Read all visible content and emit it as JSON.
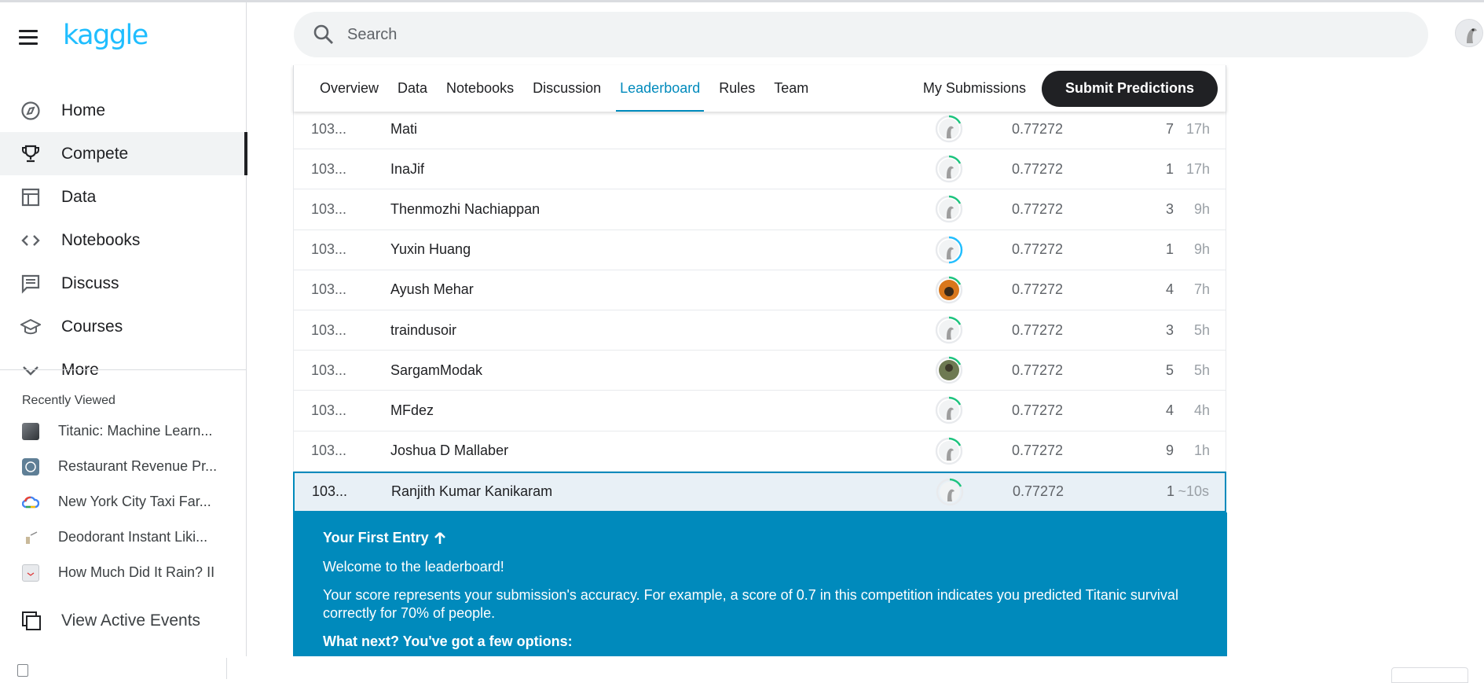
{
  "app": {
    "logo": "kaggle"
  },
  "sidebar": {
    "items": [
      {
        "label": "Home",
        "icon": "compass-icon"
      },
      {
        "label": "Compete",
        "icon": "trophy-icon",
        "active": true
      },
      {
        "label": "Data",
        "icon": "table-icon"
      },
      {
        "label": "Notebooks",
        "icon": "code-icon"
      },
      {
        "label": "Discuss",
        "icon": "comment-icon"
      },
      {
        "label": "Courses",
        "icon": "school-icon"
      },
      {
        "label": "More",
        "icon": "chevron-down-icon"
      }
    ],
    "recent_title": "Recently Viewed",
    "recent": [
      {
        "label": "Titanic: Machine Learn..."
      },
      {
        "label": "Restaurant Revenue Pr..."
      },
      {
        "label": "New York City Taxi Far..."
      },
      {
        "label": "Deodorant Instant Liki..."
      },
      {
        "label": "How Much Did It Rain? II"
      }
    ],
    "events_label": "View Active Events"
  },
  "search": {
    "placeholder": "Search"
  },
  "tabs": [
    {
      "label": "Overview"
    },
    {
      "label": "Data"
    },
    {
      "label": "Notebooks"
    },
    {
      "label": "Discussion"
    },
    {
      "label": "Leaderboard",
      "active": true
    },
    {
      "label": "Rules"
    },
    {
      "label": "Team"
    }
  ],
  "actions": {
    "my_submissions": "My Submissions",
    "submit": "Submit Predictions"
  },
  "leaderboard": {
    "rows": [
      {
        "rank": "103...",
        "team": "Mati",
        "score": "0.77272",
        "entries": "7",
        "last": "17h"
      },
      {
        "rank": "103...",
        "team": "InaJif",
        "score": "0.77272",
        "entries": "1",
        "last": "17h"
      },
      {
        "rank": "103...",
        "team": "Thenmozhi Nachiappan",
        "score": "0.77272",
        "entries": "3",
        "last": "9h"
      },
      {
        "rank": "103...",
        "team": "Yuxin Huang",
        "score": "0.77272",
        "entries": "1",
        "last": "9h"
      },
      {
        "rank": "103...",
        "team": "Ayush Mehar",
        "score": "0.77272",
        "entries": "4",
        "last": "7h"
      },
      {
        "rank": "103...",
        "team": "traindusoir",
        "score": "0.77272",
        "entries": "3",
        "last": "5h"
      },
      {
        "rank": "103...",
        "team": "SargamModak",
        "score": "0.77272",
        "entries": "5",
        "last": "5h"
      },
      {
        "rank": "103...",
        "team": "MFdez",
        "score": "0.77272",
        "entries": "4",
        "last": "4h"
      },
      {
        "rank": "103...",
        "team": "Joshua D Mallaber",
        "score": "0.77272",
        "entries": "9",
        "last": "1h"
      },
      {
        "rank": "103...",
        "team": "Ranjith Kumar Kanikaram",
        "score": "0.77272",
        "entries": "1",
        "last": "~10s"
      }
    ]
  },
  "info": {
    "title": "Your First Entry",
    "welcome": "Welcome to the leaderboard!",
    "body": "Your score represents your submission's accuracy. For example, a score of 0.7 in this competition indicates you predicted Titanic survival correctly for 70% of people.",
    "next": "What next? You've got a few options:"
  },
  "colors": {
    "accent": "#008abc",
    "brand": "#20beff",
    "dark": "#202124"
  }
}
